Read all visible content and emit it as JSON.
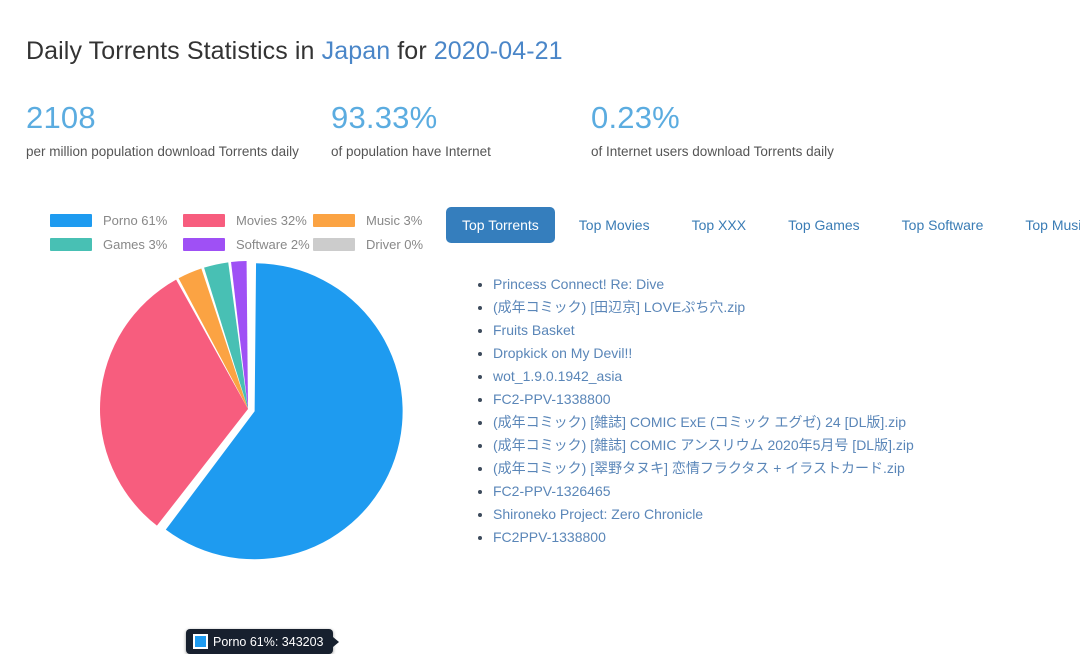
{
  "heading": {
    "prefix": "Daily Torrents Statistics in ",
    "country": "Japan",
    "middle": " for ",
    "date": "2020-04-21"
  },
  "stats": [
    {
      "value": "2108",
      "label": "per million population download Torrents daily"
    },
    {
      "value": "93.33%",
      "label": "of population have Internet"
    },
    {
      "value": "0.23%",
      "label": "of Internet users download Torrents daily"
    }
  ],
  "colors": {
    "accent_link": "#4a86c8",
    "stat_value": "#5bace0",
    "tab_active_bg": "#357ebd",
    "tooltip_bg": "#17202e"
  },
  "chart_data": {
    "type": "pie",
    "title": "",
    "legend_position": "top",
    "categories": [
      "Porno",
      "Movies",
      "Music",
      "Games",
      "Software",
      "Driver"
    ],
    "values": [
      61,
      32,
      3,
      3,
      2,
      0
    ],
    "colors": [
      "#1e9bf0",
      "#f75d7e",
      "#fba343",
      "#48c0b4",
      "#9f50f5",
      "#cccccc"
    ],
    "legend_labels": [
      "Porno 61%",
      "Movies 32%",
      "Music 3%",
      "Games 3%",
      "Software 2%",
      "Driver 0%"
    ],
    "exploded_slice": "Porno",
    "tooltip": {
      "label": "Porno 61%",
      "value": "343203",
      "text": "Porno 61%: 343203",
      "series_color": "#1e9bf0"
    }
  },
  "tabs": [
    {
      "label": "Top Torrents",
      "active": true
    },
    {
      "label": "Top Movies",
      "active": false
    },
    {
      "label": "Top XXX",
      "active": false
    },
    {
      "label": "Top Games",
      "active": false
    },
    {
      "label": "Top Software",
      "active": false
    },
    {
      "label": "Top Music",
      "active": false
    }
  ],
  "torrents": [
    "Princess Connect! Re: Dive",
    "(成年コミック) [田辺京] LOVEぷち穴.zip",
    "Fruits Basket",
    "Dropkick on My Devil!!",
    "wot_1.9.0.1942_asia",
    "FC2-PPV-1338800",
    "(成年コミック) [雑誌] COMIC ExE (コミック エグゼ) 24 [DL版].zip",
    "(成年コミック) [雑誌] COMIC アンスリウム 2020年5月号 [DL版].zip",
    "(成年コミック) [翠野タヌキ] 恋情フラクタス + イラストカード.zip",
    "FC2-PPV-1326465",
    "Shironeko Project: Zero Chronicle",
    "FC2PPV-1338800"
  ]
}
